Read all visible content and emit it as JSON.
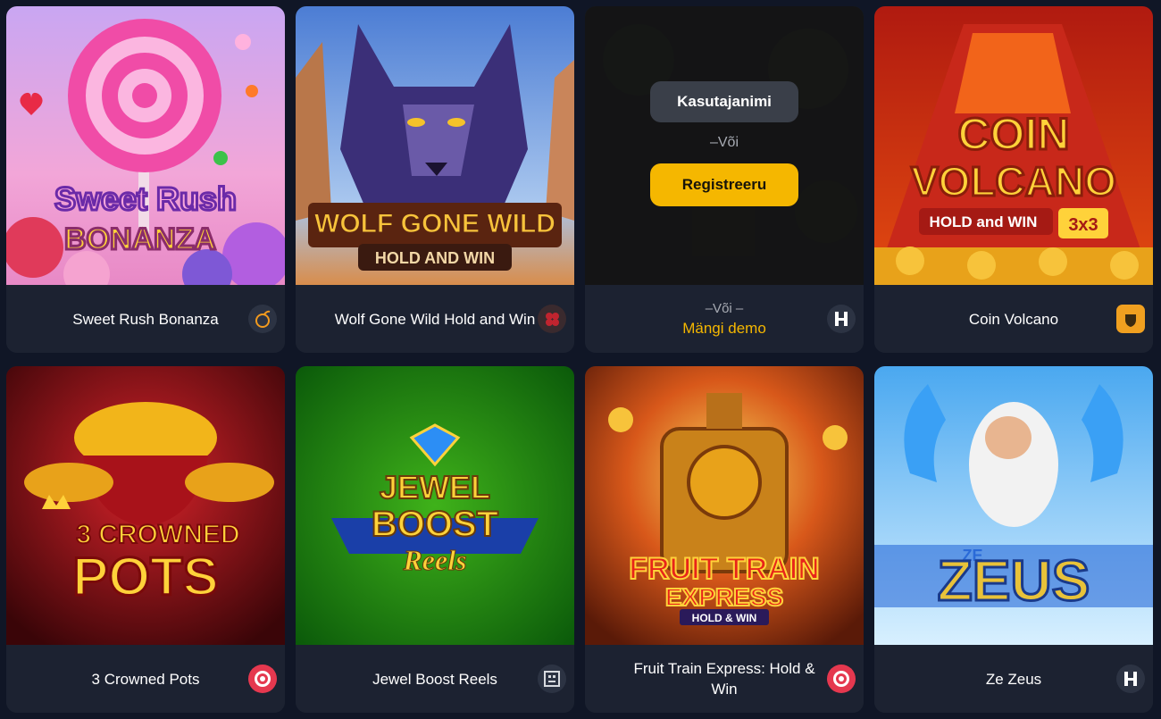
{
  "games": [
    {
      "title": "Sweet Rush Bonanza",
      "logo_lines": [
        "Sweet Rush",
        "BONANZA"
      ],
      "provider_icon": "bomb-icon"
    },
    {
      "title": "Wolf Gone Wild Hold and Win",
      "logo_lines": [
        "WOLF GONE WILD",
        "HOLD AND WIN"
      ],
      "provider_icon": "leaf-cluster-icon"
    },
    {
      "title": "",
      "provider_icon": "h-block-icon"
    },
    {
      "title": "Coin Volcano",
      "logo_lines": [
        "COIN",
        "VOLCANO",
        "HOLD and WIN",
        "3x3"
      ],
      "provider_icon": "shield-acorn-icon"
    },
    {
      "title": "3 Crowned Pots",
      "logo_lines": [
        "3 CROWNED",
        "POTS"
      ],
      "provider_icon": "target-icon"
    },
    {
      "title": "Jewel Boost Reels",
      "logo_lines": [
        "JEWEL",
        "BOOST",
        "Reels"
      ],
      "provider_icon": "tribal-mask-icon"
    },
    {
      "title": "Fruit Train Express: Hold & Win",
      "logo_lines": [
        "FRUIT TRAIN",
        "EXPRESS",
        "HOLD & WIN"
      ],
      "provider_icon": "target-icon"
    },
    {
      "title": "Ze Zeus",
      "logo_lines": [
        "ZE",
        "ZEUS"
      ],
      "provider_icon": "h-block-icon"
    }
  ],
  "hover_card": {
    "username_button": "Kasutajanimi",
    "or_text_1": "–Või",
    "register_button": "Registreeru",
    "or_text_2": "–Või –",
    "demo_link": "Mängi demo"
  },
  "colors": {
    "page_bg": "#101626",
    "card_bg": "#1c2231",
    "accent_yellow": "#f5b700",
    "provider_red": "#e5384f"
  }
}
